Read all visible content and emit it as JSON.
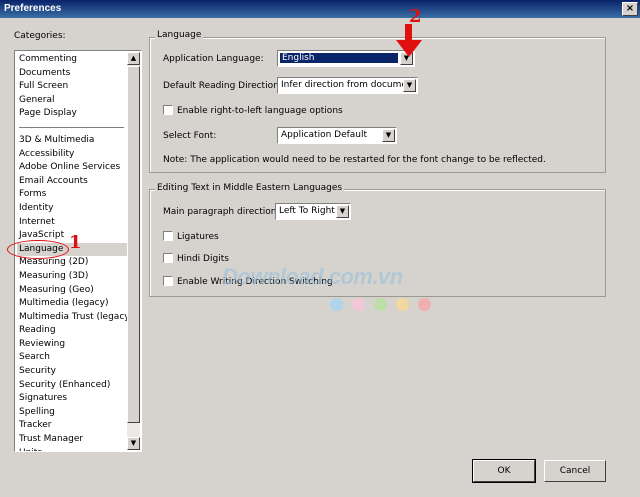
{
  "window": {
    "title": "Preferences",
    "close_glyph": "×"
  },
  "categories": {
    "label": "Categories:",
    "group1": [
      "Commenting",
      "Documents",
      "Full Screen",
      "General",
      "Page Display"
    ],
    "group2": [
      "3D & Multimedia",
      "Accessibility",
      "Adobe Online Services",
      "Email Accounts",
      "Forms",
      "Identity",
      "Internet",
      "JavaScript",
      "Language",
      "Measuring (2D)",
      "Measuring (3D)",
      "Measuring (Geo)",
      "Multimedia (legacy)",
      "Multimedia Trust (legacy)",
      "Reading",
      "Reviewing",
      "Search",
      "Security",
      "Security (Enhanced)",
      "Signatures",
      "Spelling",
      "Tracker",
      "Trust Manager",
      "Units"
    ],
    "selected": "Language"
  },
  "language": {
    "group_title": "Language",
    "app_language_label": "Application Language:",
    "app_language_value": "English",
    "reading_direction_label": "Default Reading Direction:",
    "reading_direction_value": "Infer direction from document",
    "rtl_label": "Enable right-to-left language options",
    "select_font_label": "Select Font:",
    "select_font_value": "Application Default",
    "note": "Note: The application would need to be restarted for the font change to be reflected."
  },
  "middle_eastern": {
    "group_title": "Editing Text in Middle Eastern Languages",
    "main_direction_label": "Main paragraph direction:",
    "main_direction_value": "Left To Right",
    "ligatures_label": "Ligatures",
    "hindi_label": "Hindi Digits",
    "writing_switch_label": "Enable Writing Direction Switching"
  },
  "buttons": {
    "ok": "OK",
    "cancel": "Cancel"
  },
  "annotations": {
    "step1": "1",
    "step2": "2"
  },
  "watermark": {
    "text": "Download.com.vn",
    "dot_colors": [
      "#a8d4f0",
      "#f5c6d8",
      "#b8e0a0",
      "#f8d898",
      "#f4a8a8"
    ]
  },
  "icons": {
    "scroll_up": "▲",
    "scroll_down": "▼",
    "dropdown": "▼",
    "arrow_down": "arrow-down-icon"
  }
}
